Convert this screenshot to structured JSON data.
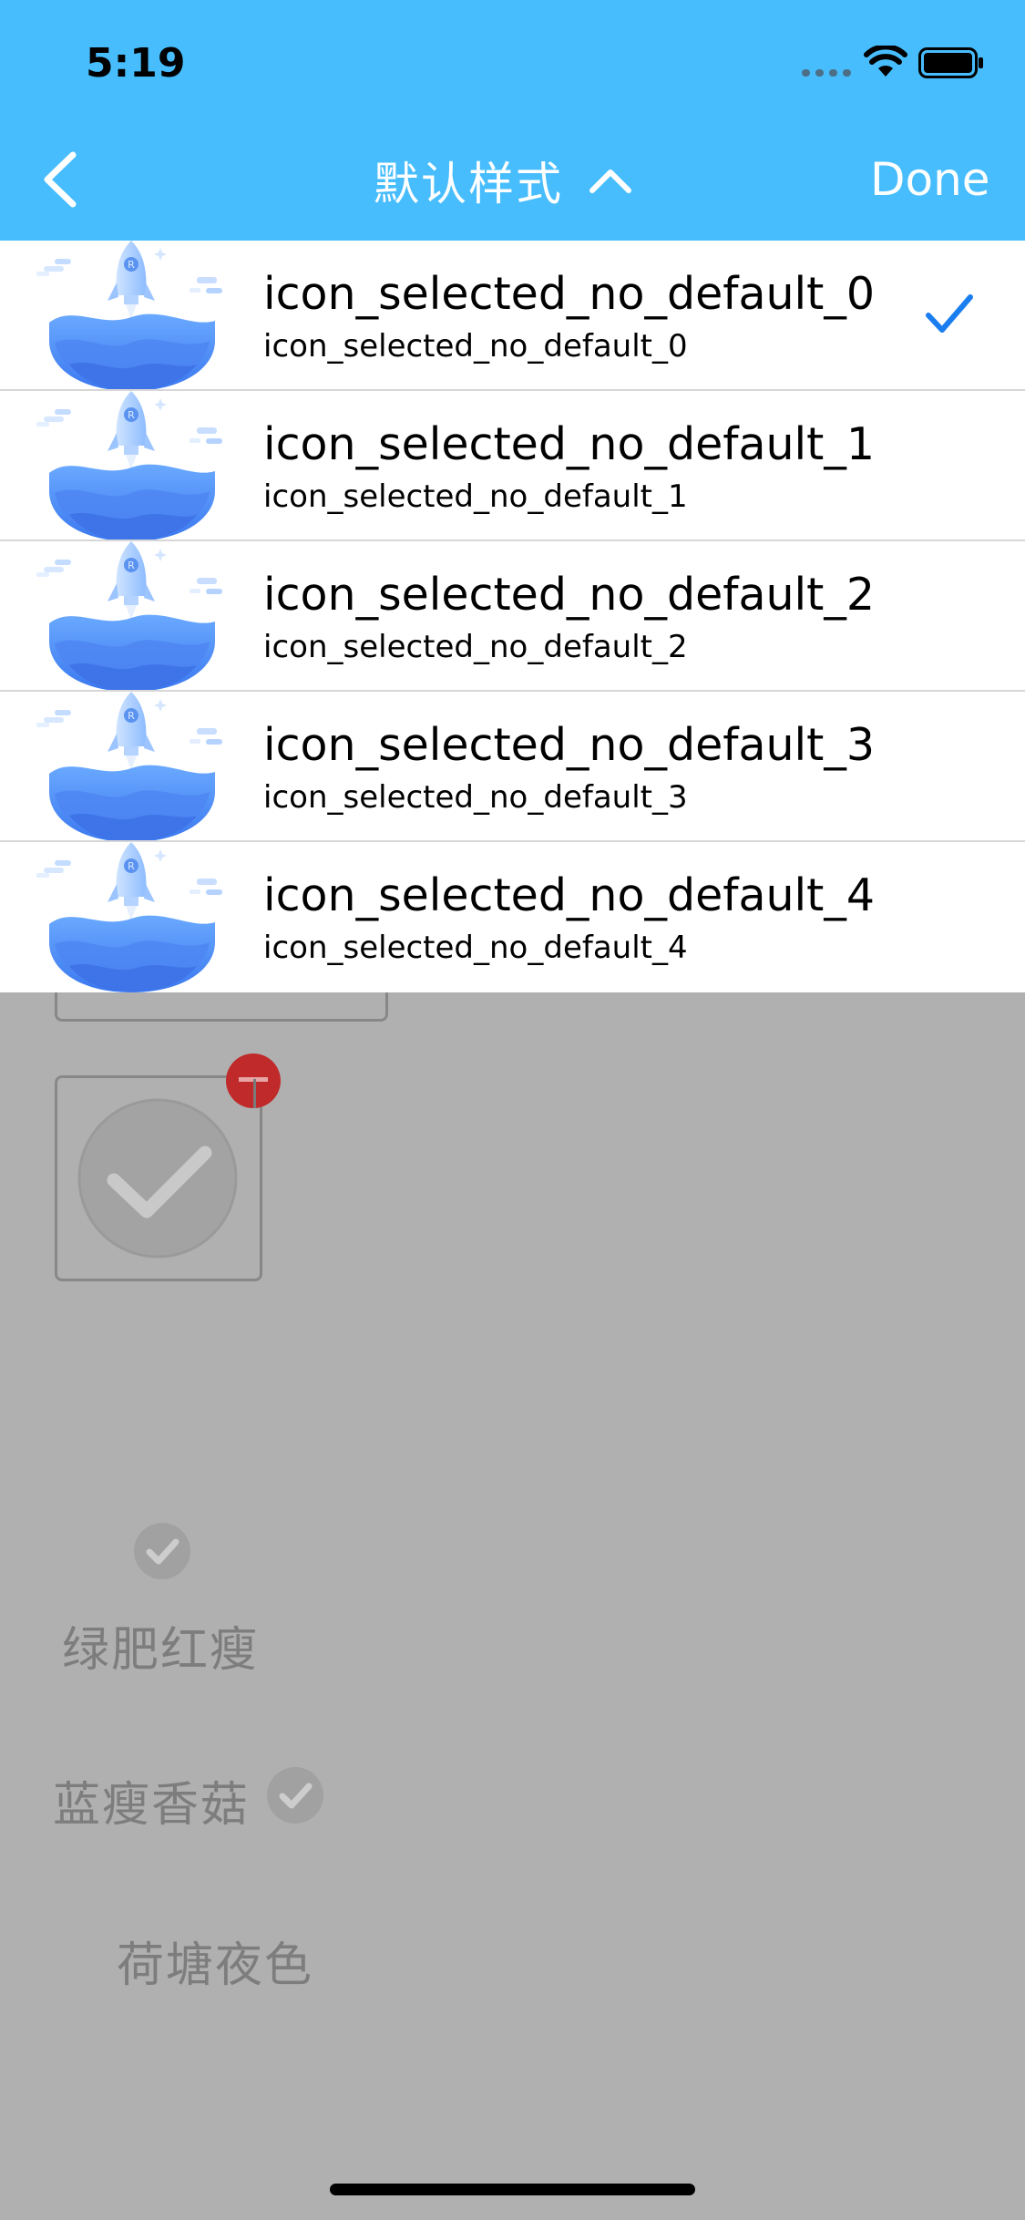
{
  "status_bar": {
    "time": "5:19"
  },
  "nav": {
    "title": "默认样式",
    "done_label": "Done"
  },
  "dropdown": {
    "items": [
      {
        "title": "icon_selected_no_default_0",
        "subtitle": "icon_selected_no_default_0",
        "selected": true
      },
      {
        "title": "icon_selected_no_default_1",
        "subtitle": "icon_selected_no_default_1",
        "selected": false
      },
      {
        "title": "icon_selected_no_default_2",
        "subtitle": "icon_selected_no_default_2",
        "selected": false
      },
      {
        "title": "icon_selected_no_default_3",
        "subtitle": "icon_selected_no_default_3",
        "selected": false
      },
      {
        "title": "icon_selected_no_default_4",
        "subtitle": "icon_selected_no_default_4",
        "selected": false
      }
    ]
  },
  "content": {
    "labels": [
      "绿肥红瘦",
      "蓝瘦香菇",
      "荷塘夜色"
    ]
  },
  "colors": {
    "nav_bar": "#47bdfd",
    "accent": "#1a7ef0",
    "overlay": "#b0b0b0",
    "badge": "#c02a2a"
  }
}
